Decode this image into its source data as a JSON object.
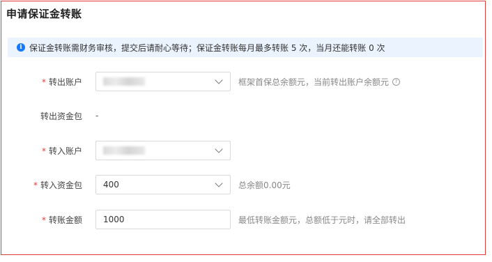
{
  "page": {
    "title": "申请保证金转账"
  },
  "notice": {
    "icon": "info-icon",
    "text": "保证金转账需财务审核，提交后请耐心等待；保证金转账每月最多转账 5 次，当月还能转账 0 次"
  },
  "form": {
    "required_mark": "*",
    "transfer_out_account": {
      "label": "转出账户",
      "hint": "框架首保总余额元，当前转出账户余额元"
    },
    "transfer_out_fund_package": {
      "label": "转出资金包",
      "value": "-"
    },
    "transfer_in_account": {
      "label": "转入账户"
    },
    "transfer_in_fund_package": {
      "label": "转入资金包",
      "value": "400",
      "hint": "总余额0.00元"
    },
    "transfer_amount": {
      "label": "转账金额",
      "value": "1000",
      "hint": "最低转账金额元，总额低于元时，请全部转出"
    }
  },
  "colors": {
    "accent": "#1677ff",
    "required": "#e23b3b",
    "notice_bg": "#eaf3fe"
  }
}
